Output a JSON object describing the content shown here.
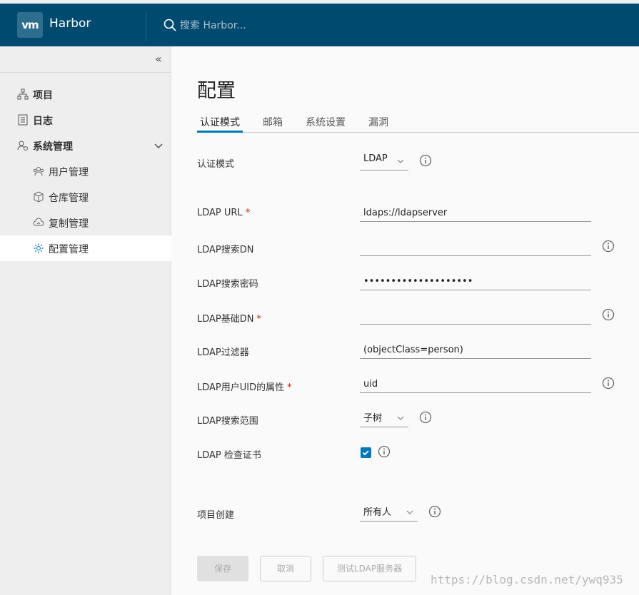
{
  "header": {
    "logo_text": "vm",
    "brand": "Harbor",
    "search_placeholder": "搜索 Harbor..."
  },
  "sidebar": {
    "collapse_glyph": "«",
    "items": [
      {
        "label": "项目"
      },
      {
        "label": "日志"
      },
      {
        "label": "系统管理"
      },
      {
        "label": "用户管理"
      },
      {
        "label": "仓库管理"
      },
      {
        "label": "复制管理"
      },
      {
        "label": "配置管理"
      }
    ]
  },
  "page": {
    "title": "配置",
    "tabs": [
      "认证模式",
      "邮箱",
      "系统设置",
      "漏洞"
    ],
    "active_tab": "认证模式"
  },
  "form": {
    "auth_mode": {
      "label": "认证模式",
      "value": "LDAP"
    },
    "ldap_url": {
      "label": "LDAP URL",
      "required": "*",
      "value": "ldaps://ldapserver"
    },
    "search_dn": {
      "label": "LDAP搜索DN",
      "value": ""
    },
    "search_password": {
      "label": "LDAP搜索密码",
      "value": "••••••••••••••••••••"
    },
    "base_dn": {
      "label": "LDAP基础DN",
      "required": "*",
      "value": ""
    },
    "filter": {
      "label": "LDAP过滤器",
      "value": "(objectClass=person)"
    },
    "uid": {
      "label": "LDAP用户UID的属性",
      "required": "*",
      "value": "uid"
    },
    "scope": {
      "label": "LDAP搜索范围",
      "value": "子树"
    },
    "verify_cert": {
      "label": "LDAP 检查证书",
      "checked": true
    },
    "project_creation": {
      "label": "项目创建",
      "value": "所有人"
    }
  },
  "buttons": {
    "save": "保存",
    "cancel": "取消",
    "test": "测试LDAP服务器"
  },
  "watermark": "https://blog.csdn.net/ywq935",
  "colors": {
    "header_bg": "#004a70",
    "accent": "#0079b8",
    "required": "#c92100"
  }
}
